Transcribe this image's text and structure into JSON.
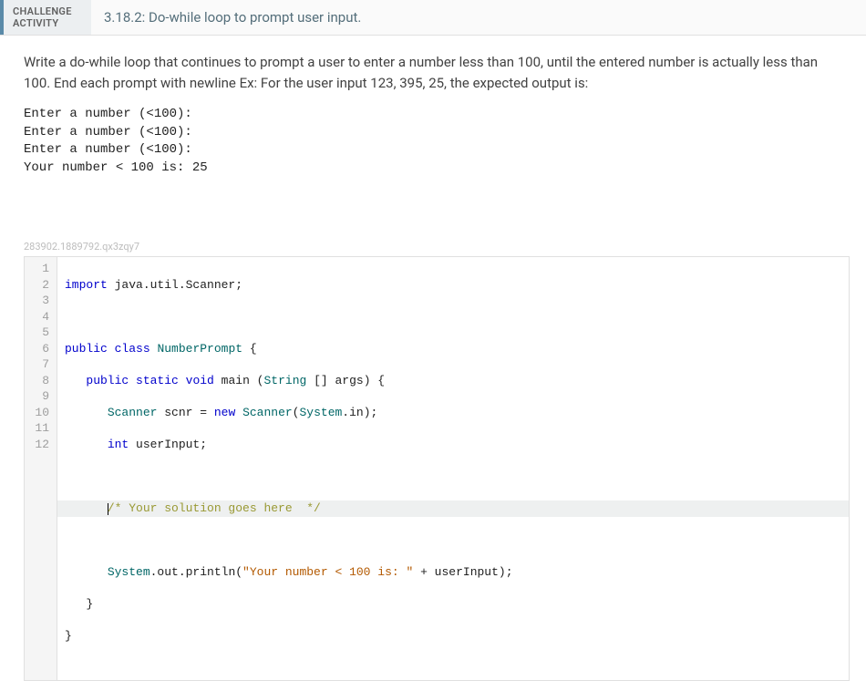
{
  "header": {
    "label_line1": "CHALLENGE",
    "label_line2": "ACTIVITY",
    "title": "3.18.2: Do-while loop to prompt user input."
  },
  "prompt": "Write a do-while loop that continues to prompt a user to enter a number less than 100, until the entered number is actually less than 100. End each prompt with newline Ex: For the user input 123, 395, 25, the expected output is:",
  "expected_output": "Enter a number (<100):\nEnter a number (<100):\nEnter a number (<100):\nYour number < 100 is: 25",
  "watermark": "283902.1889792.qx3zqy7",
  "code": {
    "line_count": 12,
    "tokens": {
      "l1_kw": "import",
      "l1_rest": " java.util.Scanner;",
      "l3_kw1": "public",
      "l3_kw2": "class",
      "l3_cls": "NumberPrompt",
      "l3_rest": " {",
      "l4_pre": "   ",
      "l4_kw1": "public",
      "l4_kw2": "static",
      "l4_kw3": "void",
      "l4_main": " main (",
      "l4_cls": "String",
      "l4_rest": " [] args) {",
      "l5_pre": "      ",
      "l5_cls1": "Scanner",
      "l5_mid": " scnr = ",
      "l5_kw": "new",
      "l5_sp": " ",
      "l5_cls2": "Scanner",
      "l5_call": "(",
      "l5_cls3": "System",
      "l5_rest": ".in);",
      "l6_pre": "      ",
      "l6_kw": "int",
      "l6_rest": " userInput;",
      "l8_pre": "      ",
      "l8_cmt": "/* Your solution goes here  */",
      "l10_pre": "      ",
      "l10_cls": "System",
      "l10_mid": ".out.println(",
      "l10_str": "\"Your number < 100 is: \"",
      "l10_rest": " + userInput);",
      "l11": "   }",
      "l12": "}"
    }
  }
}
